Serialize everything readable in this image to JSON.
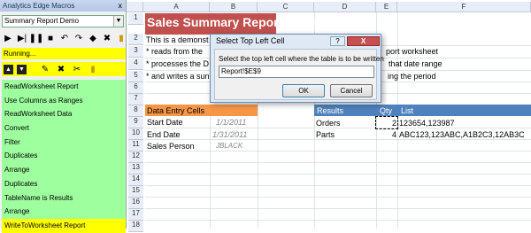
{
  "panel": {
    "title": "Analytics Edge Macros",
    "close": "x",
    "macro_select": "Summary Report Demo",
    "running": "Running...",
    "steps": [
      "ReadWorksheet Report",
      "Use Columns as Ranges",
      "ReadWorksheet Data",
      "Convert",
      "Filter",
      "Duplicates",
      "Arrange",
      "Duplicates",
      "TableName is Results",
      "Arrange",
      "WriteToWorksheet Report"
    ]
  },
  "sheet": {
    "columns": [
      "A",
      "B",
      "C",
      "D",
      "E",
      "F"
    ],
    "rows": [
      "1",
      "2",
      "3",
      "4",
      "5",
      "6",
      "7",
      "8",
      "9",
      "10",
      "11",
      "12",
      "13",
      "14",
      "15",
      "16",
      "17",
      "18"
    ],
    "title": "Sales Summary Report Example",
    "line2": "This is a demonst",
    "line3a": "* reads from the",
    "line3b": "port worksheet",
    "line4a": "* processes the D",
    "line4b": "that date range",
    "line5a": "* and writes a sun",
    "line5b": "ing the period",
    "data_entry": "Data Entry Cells",
    "start_date_label": "Start Date",
    "start_date": "1/1/2011",
    "end_date_label": "End Date",
    "end_date": "1/31/2011",
    "sales_person_label": "Sales Person",
    "sales_person": "JBLACK",
    "results": "Results",
    "qty": "Qty",
    "list": "List",
    "orders": "Orders",
    "orders_qty": "2",
    "orders_list": "123654,123987",
    "parts": "Parts",
    "parts_qty": "4",
    "parts_list": "ABC123,123ABC,A1B2C3,12AB3C"
  },
  "dialog": {
    "title": "Select Top Left Cell",
    "help": "?",
    "close": "X",
    "prompt": "Select the top left cell where the table is to be written",
    "value": "Report!$E$9",
    "ok": "OK",
    "cancel": "Cancel"
  },
  "colors": {
    "title_bg": "#c0504d",
    "orange": "#f79646",
    "blue": "#4f81bd",
    "green": "#9eff9e",
    "yellow": "#ffff00"
  }
}
